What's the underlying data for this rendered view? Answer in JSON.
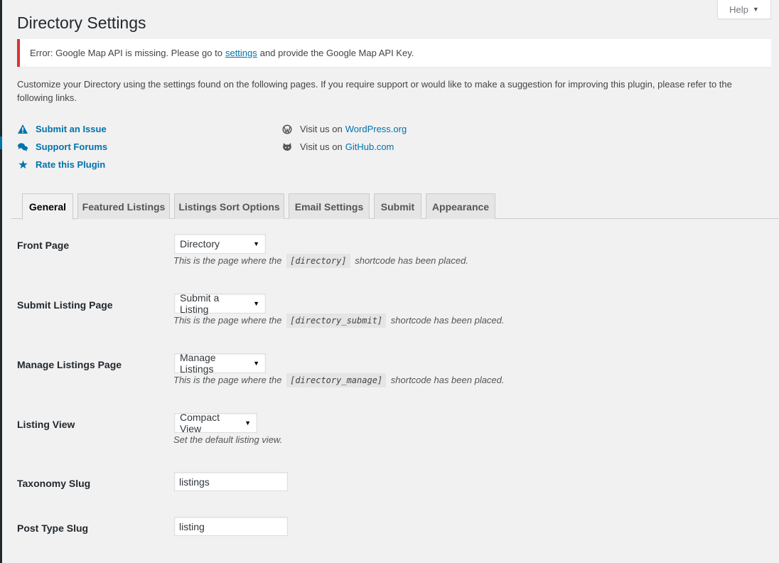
{
  "help_tab": {
    "label": "Help"
  },
  "page": {
    "title": "Directory Settings"
  },
  "notice": {
    "before": "Error: Google Map API is missing. Please go to",
    "link": "settings",
    "after": "and provide the Google Map API Key."
  },
  "intro": "Customize your Directory using the settings found on the following pages. If you require support or would like to make a suggestion for improving this plugin, please refer to the following links.",
  "links_left": [
    {
      "label": "Submit an Issue",
      "icon": "warning-icon"
    },
    {
      "label": "Support Forums",
      "icon": "comments-icon"
    },
    {
      "label": "Rate this Plugin",
      "icon": "star-icon"
    }
  ],
  "links_right": [
    {
      "prefix": "Visit us on",
      "link": "WordPress.org",
      "icon": "wordpress-icon"
    },
    {
      "prefix": "Visit us on",
      "link": "GitHub.com",
      "icon": "github-icon"
    }
  ],
  "tabs": [
    {
      "label": "General",
      "active": true
    },
    {
      "label": "Featured Listings"
    },
    {
      "label": "Listings Sort Options"
    },
    {
      "label": "Email Settings"
    },
    {
      "label": "Submit"
    },
    {
      "label": "Appearance"
    }
  ],
  "settings": {
    "front_page": {
      "label": "Front Page",
      "value": "Directory",
      "desc_before": "This is the page where the",
      "code": "[directory]",
      "desc_after": "shortcode has been placed."
    },
    "submit_page": {
      "label": "Submit Listing Page",
      "value": "Submit a Listing",
      "desc_before": "This is the page where the",
      "code": "[directory_submit]",
      "desc_after": "shortcode has been placed."
    },
    "manage_page": {
      "label": "Manage Listings Page",
      "value": "Manage Listings",
      "desc_before": "This is the page where the",
      "code": "[directory_manage]",
      "desc_after": "shortcode has been placed."
    },
    "listing_view": {
      "label": "Listing View",
      "value": "Compact View",
      "desc": "Set the default listing view."
    },
    "taxonomy_slug": {
      "label": "Taxonomy Slug",
      "value": "listings"
    },
    "post_type_slug": {
      "label": "Post Type Slug",
      "value": "listing"
    }
  },
  "colors": {
    "link": "#0073aa",
    "error": "#dc3232",
    "background": "#f1f1f1"
  }
}
